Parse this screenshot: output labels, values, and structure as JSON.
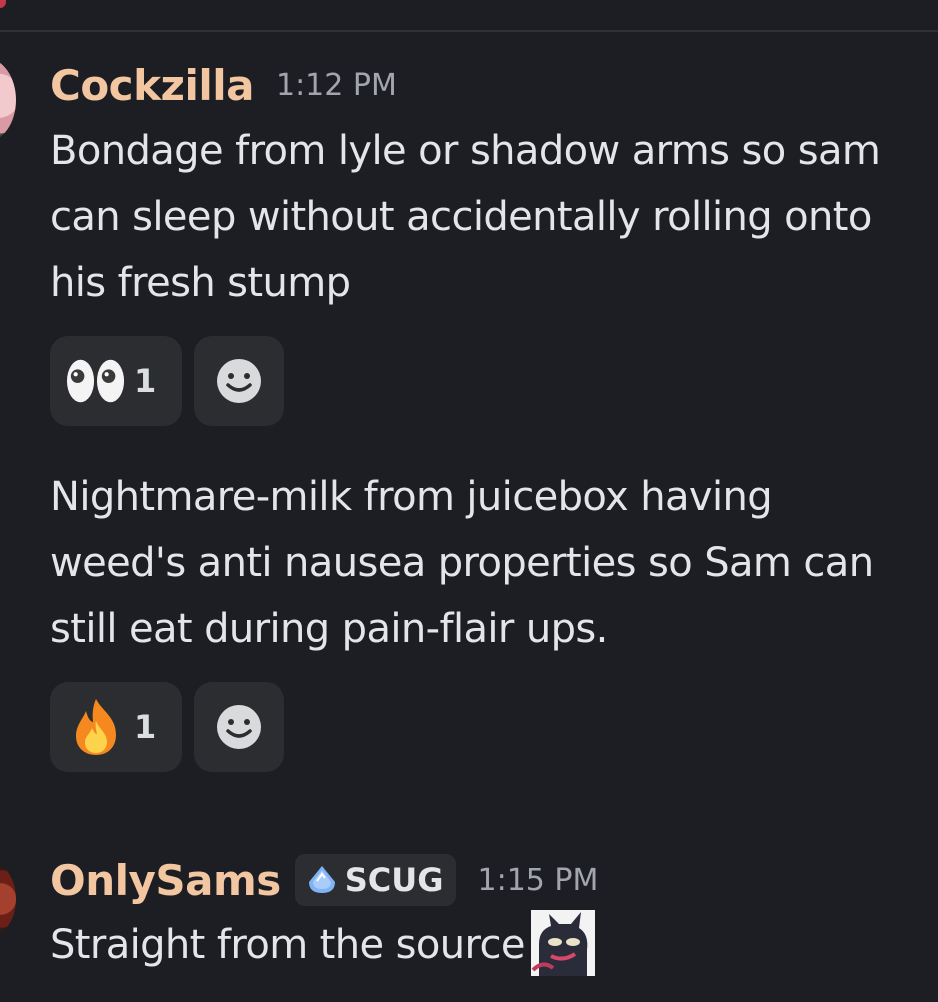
{
  "messages": [
    {
      "username": "Cockzilla",
      "timestamp": "1:12 PM",
      "lines": [
        {
          "text": "Bondage from lyle or shadow arms so sam can sleep without accidentally rolling onto his fresh stump",
          "reactions": [
            {
              "emoji": "eyes-emoji",
              "count": "1"
            },
            {
              "emoji": "add-reaction-icon"
            }
          ]
        },
        {
          "text": "Nightmare-milk from juicebox having weed's anti nausea properties so Sam can still eat during pain-flair ups.",
          "reactions": [
            {
              "emoji": "fire-emoji",
              "count": "1"
            },
            {
              "emoji": "add-reaction-icon"
            }
          ]
        }
      ]
    },
    {
      "username": "OnlySams",
      "role": {
        "name": "SCUG",
        "icon": "blue-gem-icon"
      },
      "timestamp": "1:15 PM",
      "text": "Straight from the source",
      "emote": "custom-emote-cat"
    }
  ],
  "colors": {
    "background": "#1d1e23",
    "username": "#f2c6a0",
    "timestamp": "#a2a5ad",
    "text": "#e3e5e8",
    "reaction_bg": "#2b2d31"
  }
}
